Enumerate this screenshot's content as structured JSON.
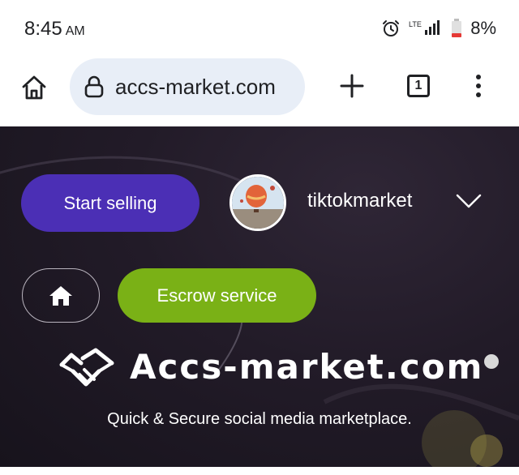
{
  "status_bar": {
    "time": "8:45",
    "ampm": "AM",
    "network": "LTE",
    "battery": "8%"
  },
  "browser": {
    "url": "accs-market.com",
    "tab_count": "1",
    "icons": [
      "home-icon",
      "lock-icon",
      "plus-icon",
      "tabs-icon",
      "more-vert-icon"
    ]
  },
  "hero": {
    "start_selling_label": "Start selling",
    "username": "tiktokmarket",
    "escrow_label": "Escrow service",
    "logo_text": "Accs-market.com",
    "tagline": "Quick & Secure social media marketplace."
  },
  "colors": {
    "start_selling_bg": "#4b2fb5",
    "escrow_bg": "#7ab116",
    "hero_bg": "#221b28",
    "url_pill_bg": "#e8eef7"
  }
}
